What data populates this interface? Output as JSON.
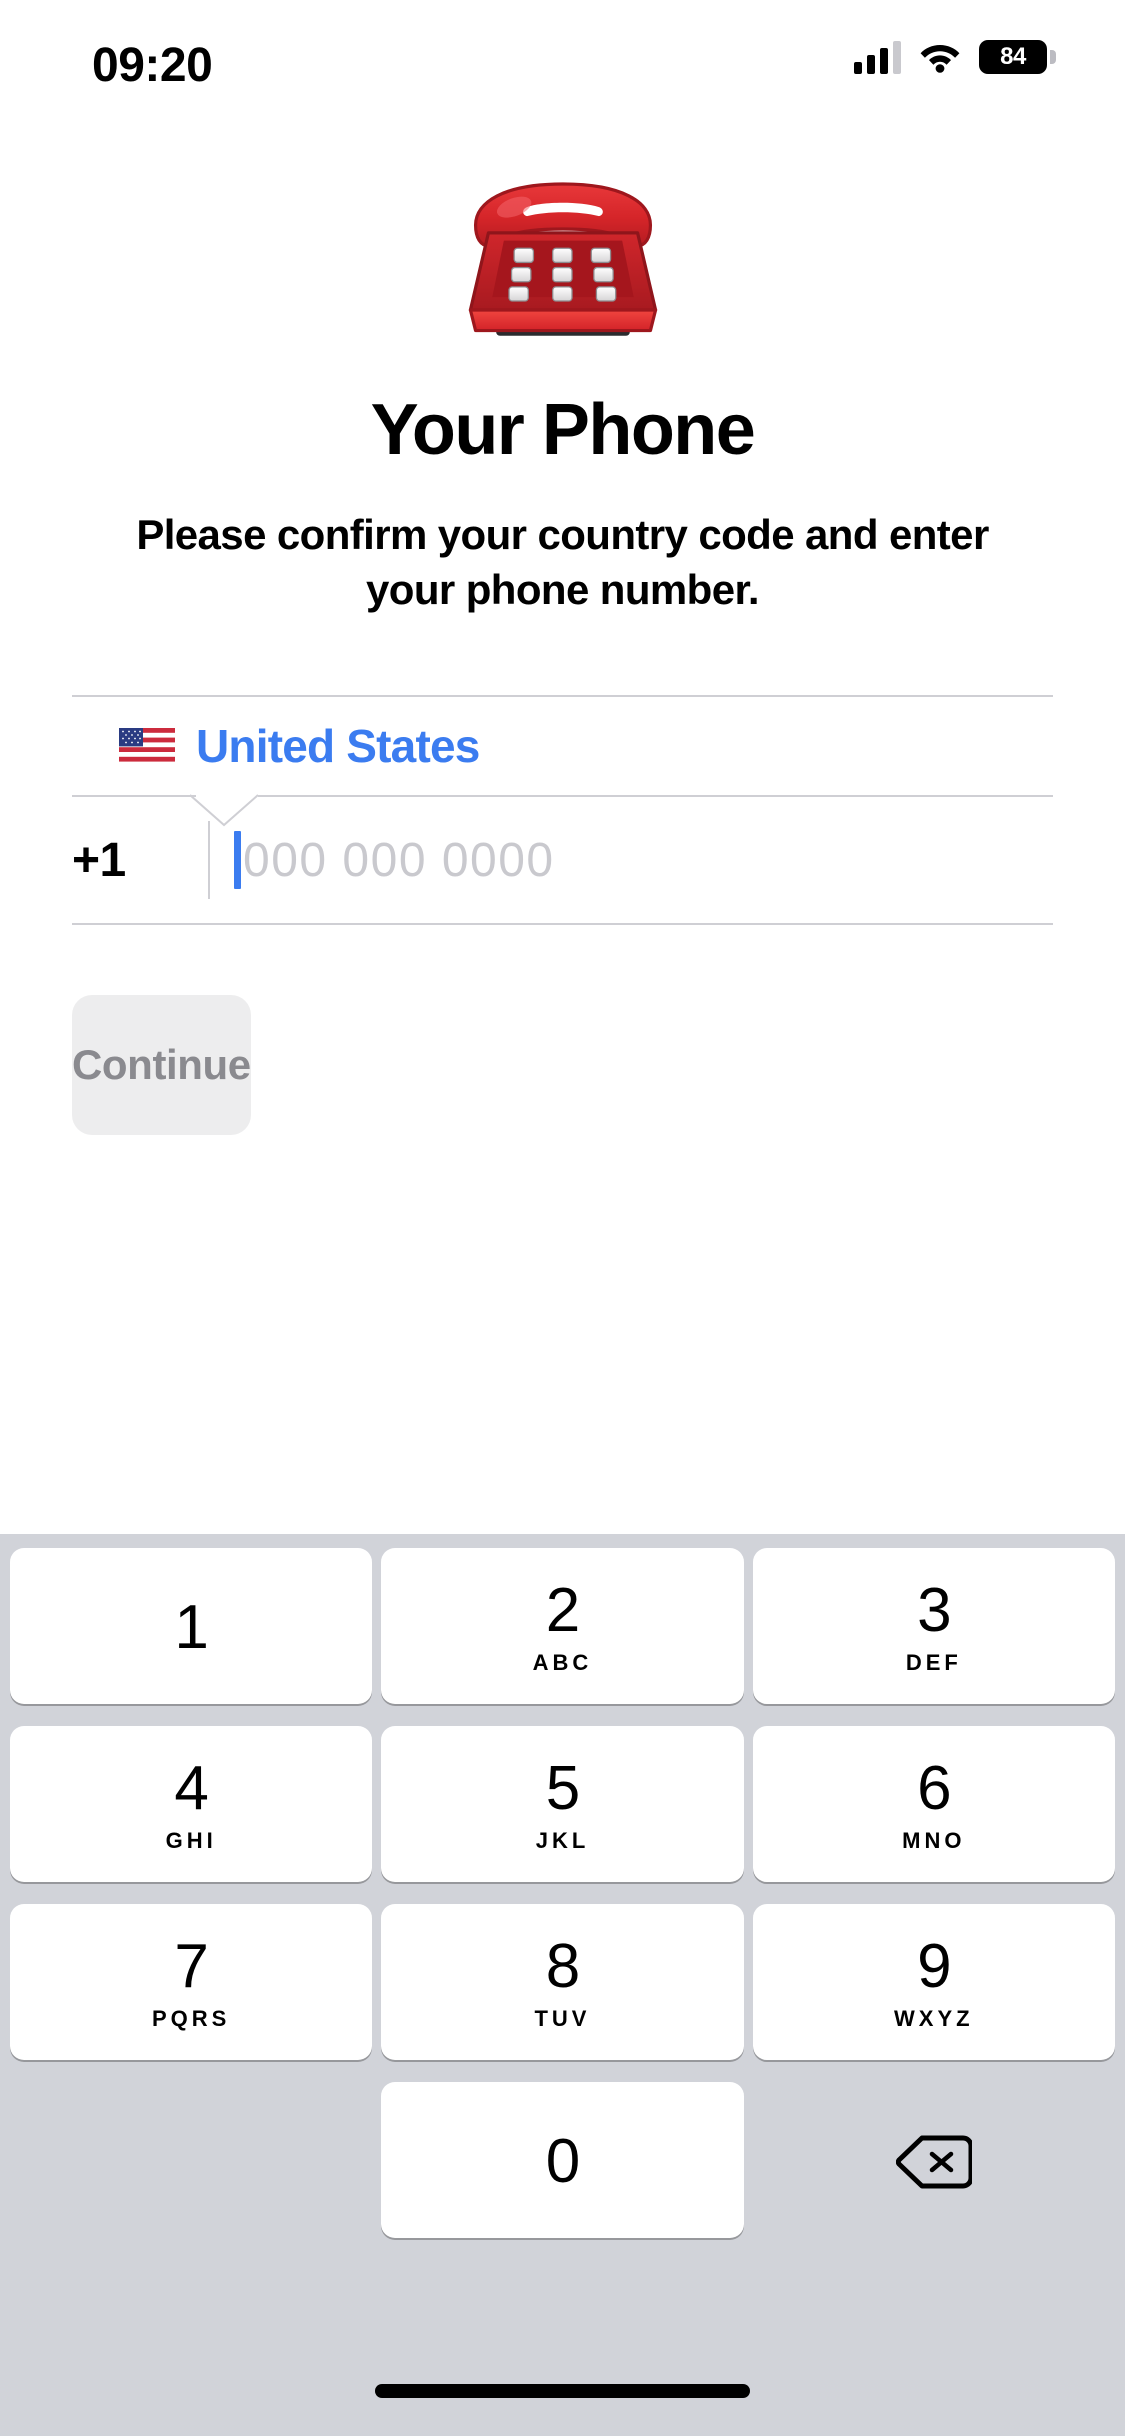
{
  "status_bar": {
    "time": "09:20",
    "battery_level": "84",
    "signal_icon": "cellular-bars-icon",
    "wifi_icon": "wifi-icon",
    "battery_icon": "battery-icon"
  },
  "hero": {
    "emoji_icon": "telephone-emoji",
    "title": "Your Phone",
    "subtitle": "Please confirm your country code and enter your phone number."
  },
  "country_selector": {
    "flag_icon": "us-flag-icon",
    "country_name": "United States",
    "accent_color": "#3b7cf0"
  },
  "phone_input": {
    "dial_code": "+1",
    "value": "",
    "placeholder": "000 000 0000",
    "caret_color": "#3b7cf0",
    "placeholder_color": "#c9c9ce"
  },
  "continue_button": {
    "label": "Continue",
    "enabled": false,
    "background": "#ededee",
    "text_color": "#8a8a8f"
  },
  "keypad": {
    "background": "#d1d3d9",
    "rows": [
      [
        {
          "digit": "1",
          "letters": ""
        },
        {
          "digit": "2",
          "letters": "ABC"
        },
        {
          "digit": "3",
          "letters": "DEF"
        }
      ],
      [
        {
          "digit": "4",
          "letters": "GHI"
        },
        {
          "digit": "5",
          "letters": "JKL"
        },
        {
          "digit": "6",
          "letters": "MNO"
        }
      ],
      [
        {
          "digit": "7",
          "letters": "PQRS"
        },
        {
          "digit": "8",
          "letters": "TUV"
        },
        {
          "digit": "9",
          "letters": "WXYZ"
        }
      ],
      [
        {
          "digit": "",
          "letters": ""
        },
        {
          "digit": "0",
          "letters": ""
        },
        {
          "digit": "",
          "letters": "",
          "icon": "backspace-icon"
        }
      ]
    ]
  },
  "home_indicator": {
    "icon": "home-indicator"
  }
}
